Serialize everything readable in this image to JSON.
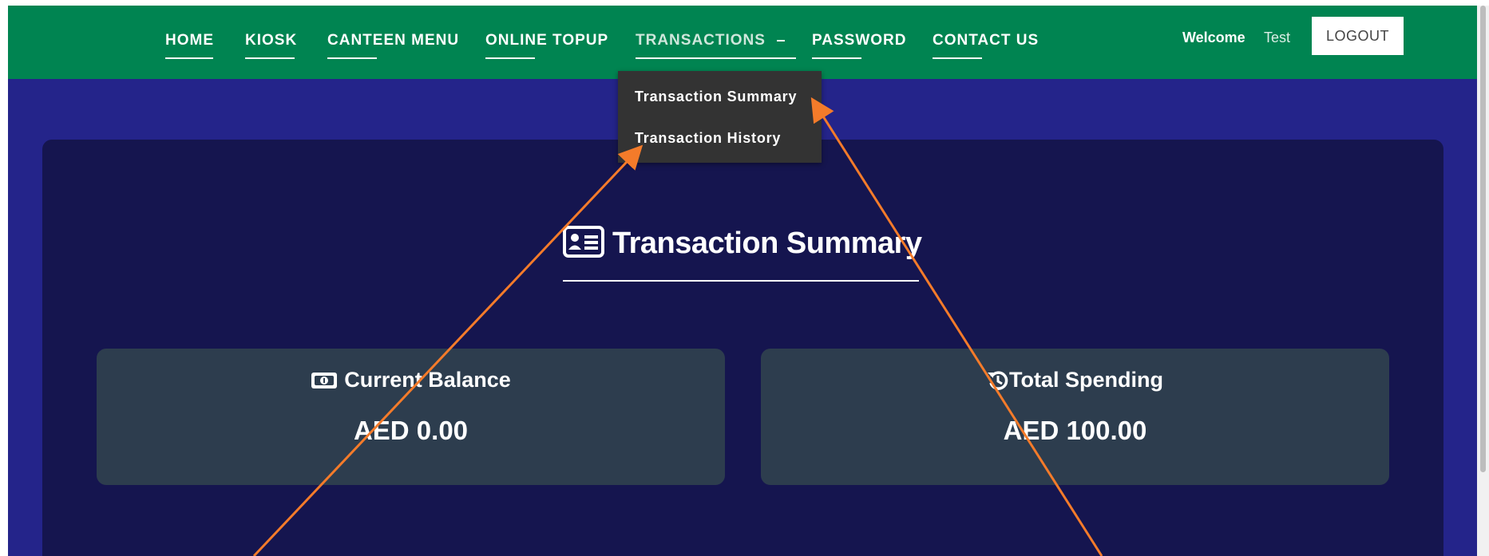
{
  "nav": {
    "home": "HOME",
    "kiosk": "KIOSK",
    "canteen_menu": "CANTEEN MENU",
    "online_topup": "ONLINE TOPUP",
    "transactions": "TRANSACTIONS",
    "password": "PASSWORD",
    "contact_us": "CONTACT US"
  },
  "user": {
    "welcome": "Welcome",
    "name": "Test",
    "logout": "LOGOUT"
  },
  "dropdown": {
    "items": [
      "Transaction Summary",
      "Transaction History"
    ]
  },
  "main": {
    "title": "Transaction Summary",
    "title_icon": "id-card-icon"
  },
  "cards": [
    {
      "icon": "money-bill-icon",
      "label": "Current Balance",
      "value": "AED 0.00"
    },
    {
      "icon": "history-icon",
      "label": "Total Spending",
      "value": "AED 100.00"
    }
  ],
  "colors": {
    "navbar": "#008451",
    "background": "#24248a",
    "panel": "#15154f",
    "card": "#2d3d4e",
    "dropdown": "#333333",
    "annotation_arrow": "#f47b2a"
  }
}
